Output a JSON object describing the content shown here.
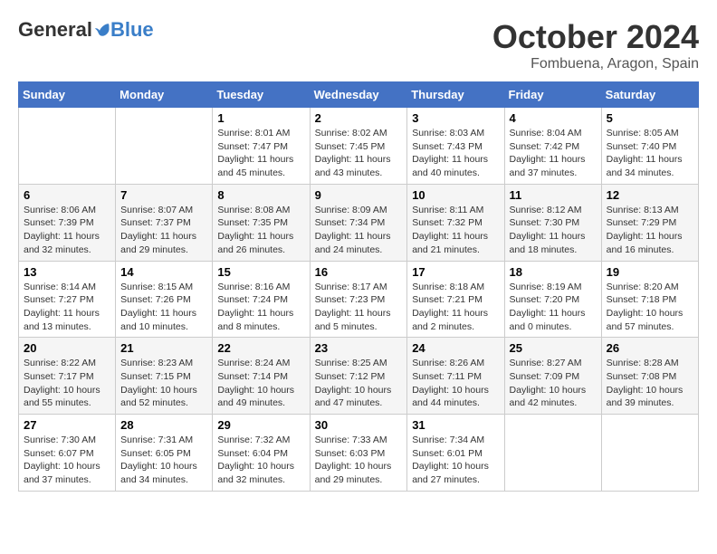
{
  "logo": {
    "general": "General",
    "blue": "Blue"
  },
  "title": "October 2024",
  "location": "Fombuena, Aragon, Spain",
  "days_of_week": [
    "Sunday",
    "Monday",
    "Tuesday",
    "Wednesday",
    "Thursday",
    "Friday",
    "Saturday"
  ],
  "weeks": [
    [
      {
        "day": null,
        "info": ""
      },
      {
        "day": null,
        "info": ""
      },
      {
        "day": "1",
        "info": "Sunrise: 8:01 AM\nSunset: 7:47 PM\nDaylight: 11 hours and 45 minutes."
      },
      {
        "day": "2",
        "info": "Sunrise: 8:02 AM\nSunset: 7:45 PM\nDaylight: 11 hours and 43 minutes."
      },
      {
        "day": "3",
        "info": "Sunrise: 8:03 AM\nSunset: 7:43 PM\nDaylight: 11 hours and 40 minutes."
      },
      {
        "day": "4",
        "info": "Sunrise: 8:04 AM\nSunset: 7:42 PM\nDaylight: 11 hours and 37 minutes."
      },
      {
        "day": "5",
        "info": "Sunrise: 8:05 AM\nSunset: 7:40 PM\nDaylight: 11 hours and 34 minutes."
      }
    ],
    [
      {
        "day": "6",
        "info": "Sunrise: 8:06 AM\nSunset: 7:39 PM\nDaylight: 11 hours and 32 minutes."
      },
      {
        "day": "7",
        "info": "Sunrise: 8:07 AM\nSunset: 7:37 PM\nDaylight: 11 hours and 29 minutes."
      },
      {
        "day": "8",
        "info": "Sunrise: 8:08 AM\nSunset: 7:35 PM\nDaylight: 11 hours and 26 minutes."
      },
      {
        "day": "9",
        "info": "Sunrise: 8:09 AM\nSunset: 7:34 PM\nDaylight: 11 hours and 24 minutes."
      },
      {
        "day": "10",
        "info": "Sunrise: 8:11 AM\nSunset: 7:32 PM\nDaylight: 11 hours and 21 minutes."
      },
      {
        "day": "11",
        "info": "Sunrise: 8:12 AM\nSunset: 7:30 PM\nDaylight: 11 hours and 18 minutes."
      },
      {
        "day": "12",
        "info": "Sunrise: 8:13 AM\nSunset: 7:29 PM\nDaylight: 11 hours and 16 minutes."
      }
    ],
    [
      {
        "day": "13",
        "info": "Sunrise: 8:14 AM\nSunset: 7:27 PM\nDaylight: 11 hours and 13 minutes."
      },
      {
        "day": "14",
        "info": "Sunrise: 8:15 AM\nSunset: 7:26 PM\nDaylight: 11 hours and 10 minutes."
      },
      {
        "day": "15",
        "info": "Sunrise: 8:16 AM\nSunset: 7:24 PM\nDaylight: 11 hours and 8 minutes."
      },
      {
        "day": "16",
        "info": "Sunrise: 8:17 AM\nSunset: 7:23 PM\nDaylight: 11 hours and 5 minutes."
      },
      {
        "day": "17",
        "info": "Sunrise: 8:18 AM\nSunset: 7:21 PM\nDaylight: 11 hours and 2 minutes."
      },
      {
        "day": "18",
        "info": "Sunrise: 8:19 AM\nSunset: 7:20 PM\nDaylight: 11 hours and 0 minutes."
      },
      {
        "day": "19",
        "info": "Sunrise: 8:20 AM\nSunset: 7:18 PM\nDaylight: 10 hours and 57 minutes."
      }
    ],
    [
      {
        "day": "20",
        "info": "Sunrise: 8:22 AM\nSunset: 7:17 PM\nDaylight: 10 hours and 55 minutes."
      },
      {
        "day": "21",
        "info": "Sunrise: 8:23 AM\nSunset: 7:15 PM\nDaylight: 10 hours and 52 minutes."
      },
      {
        "day": "22",
        "info": "Sunrise: 8:24 AM\nSunset: 7:14 PM\nDaylight: 10 hours and 49 minutes."
      },
      {
        "day": "23",
        "info": "Sunrise: 8:25 AM\nSunset: 7:12 PM\nDaylight: 10 hours and 47 minutes."
      },
      {
        "day": "24",
        "info": "Sunrise: 8:26 AM\nSunset: 7:11 PM\nDaylight: 10 hours and 44 minutes."
      },
      {
        "day": "25",
        "info": "Sunrise: 8:27 AM\nSunset: 7:09 PM\nDaylight: 10 hours and 42 minutes."
      },
      {
        "day": "26",
        "info": "Sunrise: 8:28 AM\nSunset: 7:08 PM\nDaylight: 10 hours and 39 minutes."
      }
    ],
    [
      {
        "day": "27",
        "info": "Sunrise: 7:30 AM\nSunset: 6:07 PM\nDaylight: 10 hours and 37 minutes."
      },
      {
        "day": "28",
        "info": "Sunrise: 7:31 AM\nSunset: 6:05 PM\nDaylight: 10 hours and 34 minutes."
      },
      {
        "day": "29",
        "info": "Sunrise: 7:32 AM\nSunset: 6:04 PM\nDaylight: 10 hours and 32 minutes."
      },
      {
        "day": "30",
        "info": "Sunrise: 7:33 AM\nSunset: 6:03 PM\nDaylight: 10 hours and 29 minutes."
      },
      {
        "day": "31",
        "info": "Sunrise: 7:34 AM\nSunset: 6:01 PM\nDaylight: 10 hours and 27 minutes."
      },
      {
        "day": null,
        "info": ""
      },
      {
        "day": null,
        "info": ""
      }
    ]
  ]
}
